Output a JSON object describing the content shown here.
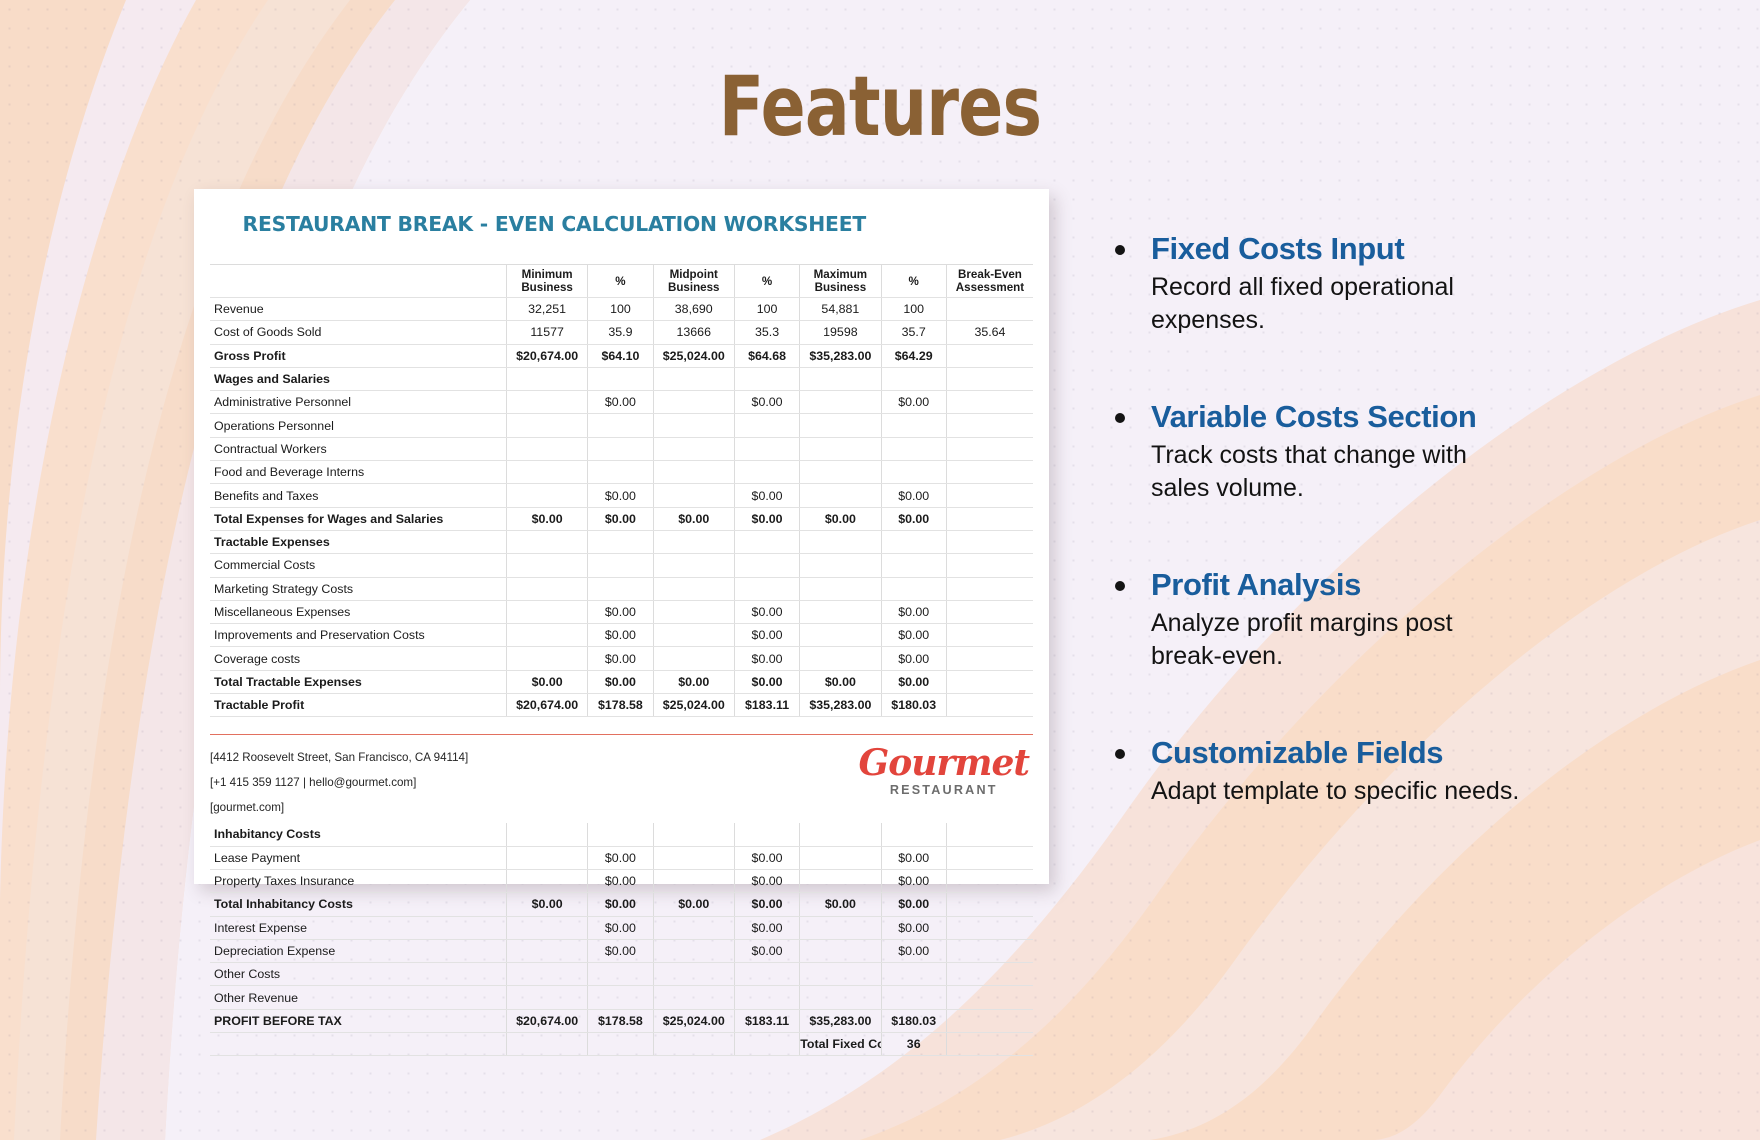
{
  "page": {
    "title": "Features",
    "title_color": "#8a6134",
    "background_color": "#f5f0f8",
    "wave_colors": [
      "#f8dcc8",
      "#f6e4dc",
      "#f2ece f",
      "#f5e0d2"
    ]
  },
  "worksheet": {
    "title": "RESTAURANT BREAK - EVEN CALCULATION WORKSHEET",
    "title_color": "#2a7fa0",
    "headers": [
      "",
      "Minimum Business",
      "%",
      "Midpoint Business",
      "%",
      "Maximum Business",
      "%",
      "Break-Even Assessment"
    ],
    "header_lines": {
      "h0": "",
      "h1a": "Minimum",
      "h1b": "Business",
      "h2": "%",
      "h3a": "Midpoint",
      "h3b": "Business",
      "h4": "%",
      "h5a": "Maximum",
      "h5b": "Business",
      "h6": "%",
      "h7a": "Break-Even",
      "h7b": "Assessment"
    },
    "rows_top": [
      {
        "label": "Revenue",
        "bold": false,
        "cells": [
          "32,251",
          "100",
          "38,690",
          "100",
          "54,881",
          "100",
          ""
        ]
      },
      {
        "label": "Cost of Goods Sold",
        "bold": false,
        "cells": [
          "11577",
          "35.9",
          "13666",
          "35.3",
          "19598",
          "35.7",
          "35.64"
        ]
      },
      {
        "label": "Gross Profit",
        "bold": true,
        "cells": [
          "$20,674.00",
          "$64.10",
          "$25,024.00",
          "$64.68",
          "$35,283.00",
          "$64.29",
          ""
        ]
      },
      {
        "label": "Wages and Salaries",
        "bold": true,
        "cells": [
          "",
          "",
          "",
          "",
          "",
          "",
          ""
        ]
      },
      {
        "label": "Administrative Personnel",
        "bold": false,
        "cells": [
          "",
          "$0.00",
          "",
          "$0.00",
          "",
          "$0.00",
          ""
        ]
      },
      {
        "label": "Operations Personnel",
        "bold": false,
        "cells": [
          "",
          "",
          "",
          "",
          "",
          "",
          ""
        ]
      },
      {
        "label": "Contractual Workers",
        "bold": false,
        "cells": [
          "",
          "",
          "",
          "",
          "",
          "",
          ""
        ]
      },
      {
        "label": "Food and Beverage Interns",
        "bold": false,
        "cells": [
          "",
          "",
          "",
          "",
          "",
          "",
          ""
        ]
      },
      {
        "label": "Benefits and Taxes",
        "bold": false,
        "cells": [
          "",
          "$0.00",
          "",
          "$0.00",
          "",
          "$0.00",
          ""
        ]
      },
      {
        "label": "Total Expenses for Wages and Salaries",
        "bold": true,
        "cells": [
          "$0.00",
          "$0.00",
          "$0.00",
          "$0.00",
          "$0.00",
          "$0.00",
          ""
        ]
      },
      {
        "label": "Tractable Expenses",
        "bold": true,
        "cells": [
          "",
          "",
          "",
          "",
          "",
          "",
          ""
        ]
      },
      {
        "label": "Commercial Costs",
        "bold": false,
        "cells": [
          "",
          "",
          "",
          "",
          "",
          "",
          ""
        ]
      },
      {
        "label": "Marketing Strategy Costs",
        "bold": false,
        "cells": [
          "",
          "",
          "",
          "",
          "",
          "",
          ""
        ]
      },
      {
        "label": "Miscellaneous Expenses",
        "bold": false,
        "cells": [
          "",
          "$0.00",
          "",
          "$0.00",
          "",
          "$0.00",
          ""
        ]
      },
      {
        "label": "Improvements and Preservation Costs",
        "bold": false,
        "cells": [
          "",
          "$0.00",
          "",
          "$0.00",
          "",
          "$0.00",
          ""
        ]
      },
      {
        "label": "Coverage costs",
        "bold": false,
        "cells": [
          "",
          "$0.00",
          "",
          "$0.00",
          "",
          "$0.00",
          ""
        ]
      },
      {
        "label": "Total Tractable Expenses",
        "bold": true,
        "cells": [
          "$0.00",
          "$0.00",
          "$0.00",
          "$0.00",
          "$0.00",
          "$0.00",
          ""
        ]
      },
      {
        "label": "Tractable Profit",
        "bold": true,
        "cells": [
          "$20,674.00",
          "$178.58",
          "$25,024.00",
          "$183.11",
          "$35,283.00",
          "$180.03",
          ""
        ]
      }
    ],
    "rows_bottom": [
      {
        "label": "Inhabitancy Costs",
        "bold": true,
        "cells": [
          "",
          "",
          "",
          "",
          "",
          "",
          ""
        ]
      },
      {
        "label": "Lease Payment",
        "bold": false,
        "cells": [
          "",
          "$0.00",
          "",
          "$0.00",
          "",
          "$0.00",
          ""
        ]
      },
      {
        "label": "Property Taxes Insurance",
        "bold": false,
        "cells": [
          "",
          "$0.00",
          "",
          "$0.00",
          "",
          "$0.00",
          ""
        ]
      },
      {
        "label": "Total Inhabitancy Costs",
        "bold": true,
        "cells": [
          "$0.00",
          "$0.00",
          "$0.00",
          "$0.00",
          "$0.00",
          "$0.00",
          ""
        ]
      },
      {
        "label": "Interest Expense",
        "bold": false,
        "cells": [
          "",
          "$0.00",
          "",
          "$0.00",
          "",
          "$0.00",
          ""
        ]
      },
      {
        "label": "Depreciation Expense",
        "bold": false,
        "cells": [
          "",
          "$0.00",
          "",
          "$0.00",
          "",
          "$0.00",
          ""
        ]
      },
      {
        "label": "Other Costs",
        "bold": false,
        "cells": [
          "",
          "",
          "",
          "",
          "",
          "",
          ""
        ]
      },
      {
        "label": "Other Revenue",
        "bold": false,
        "cells": [
          "",
          "",
          "",
          "",
          "",
          "",
          ""
        ]
      },
      {
        "label": "PROFIT BEFORE TAX",
        "bold": true,
        "cells": [
          "$20,674.00",
          "$178.58",
          "$25,024.00",
          "$183.11",
          "$35,283.00",
          "$180.03",
          ""
        ]
      },
      {
        "label": "",
        "bold": true,
        "cells": [
          "",
          "",
          "",
          "",
          "Total Fixed Costs",
          "36",
          ""
        ]
      }
    ],
    "contact": {
      "address": "[4412 Roosevelt Street, San Francisco, CA 94114]",
      "phone_email": "[+1 415 359 1127 | hello@gourmet.com]",
      "website": "[gourmet.com]"
    },
    "logo": {
      "name": "Gourmet",
      "subtitle": "RESTAURANT",
      "color": "#e2453c"
    }
  },
  "features": [
    {
      "heading": "Fixed Costs Input",
      "body": "Record all fixed operational expenses."
    },
    {
      "heading": "Variable Costs Section",
      "body": "Track costs that change with sales volume."
    },
    {
      "heading": "Profit Analysis",
      "body": "Analyze profit margins post break-even."
    },
    {
      "heading": "Customizable Fields",
      "body": "Adapt template to specific needs."
    }
  ]
}
